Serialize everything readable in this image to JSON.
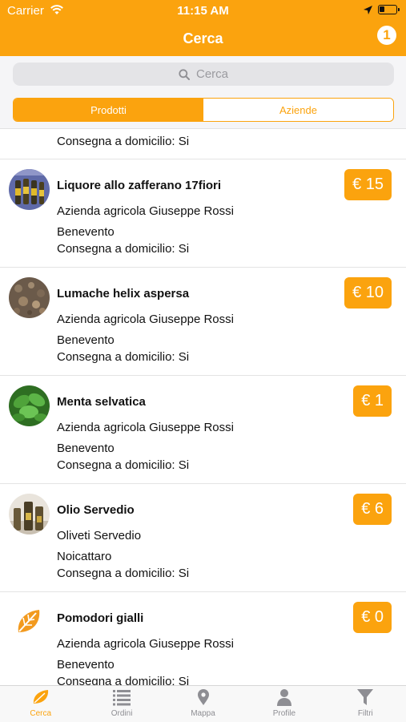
{
  "status_bar": {
    "carrier": "Carrier",
    "time": "11:15 AM"
  },
  "header": {
    "title": "Cerca",
    "badge": "1"
  },
  "search": {
    "placeholder": "Cerca"
  },
  "segments": [
    {
      "label": "Prodotti",
      "active": true
    },
    {
      "label": "Aziende",
      "active": false
    }
  ],
  "partial_row": {
    "delivery": "Consegna a domicilio: Si"
  },
  "items": [
    {
      "name": "Liquore allo zafferano 17fiori",
      "company": "Azienda agricola Giuseppe Rossi",
      "city": "Benevento",
      "delivery": "Consegna a domicilio: Si",
      "price": "€ 15",
      "thumb": "liquor-bottles"
    },
    {
      "name": "Lumache helix aspersa",
      "company": "Azienda agricola Giuseppe Rossi",
      "city": "Benevento",
      "delivery": "Consegna a domicilio: Si",
      "price": "€ 10",
      "thumb": "snails"
    },
    {
      "name": "Menta selvatica",
      "company": "Azienda agricola Giuseppe Rossi",
      "city": "Benevento",
      "delivery": "Consegna a domicilio: Si",
      "price": "€ 1",
      "thumb": "mint-leaves"
    },
    {
      "name": "Olio Servedio",
      "company": "Oliveti Servedio",
      "city": "Noicattaro",
      "delivery": "Consegna a domicilio: Si",
      "price": "€ 6",
      "thumb": "oil-bottles"
    },
    {
      "name": "Pomodori gialli",
      "company": "Azienda agricola Giuseppe Rossi",
      "city": "Benevento",
      "delivery": "Consegna a domicilio: Si",
      "price": "€ 0",
      "thumb": "app-leaf-logo"
    }
  ],
  "tabbar": [
    {
      "label": "Cerca",
      "icon": "leaf-icon",
      "active": true
    },
    {
      "label": "Ordini",
      "icon": "list-icon",
      "active": false
    },
    {
      "label": "Mappa",
      "icon": "map-pin-icon",
      "active": false
    },
    {
      "label": "Profile",
      "icon": "person-icon",
      "active": false
    },
    {
      "label": "Filtri",
      "icon": "filter-icon",
      "active": false
    }
  ],
  "colors": {
    "accent": "#fba30e",
    "inactive": "#8e8e93"
  }
}
